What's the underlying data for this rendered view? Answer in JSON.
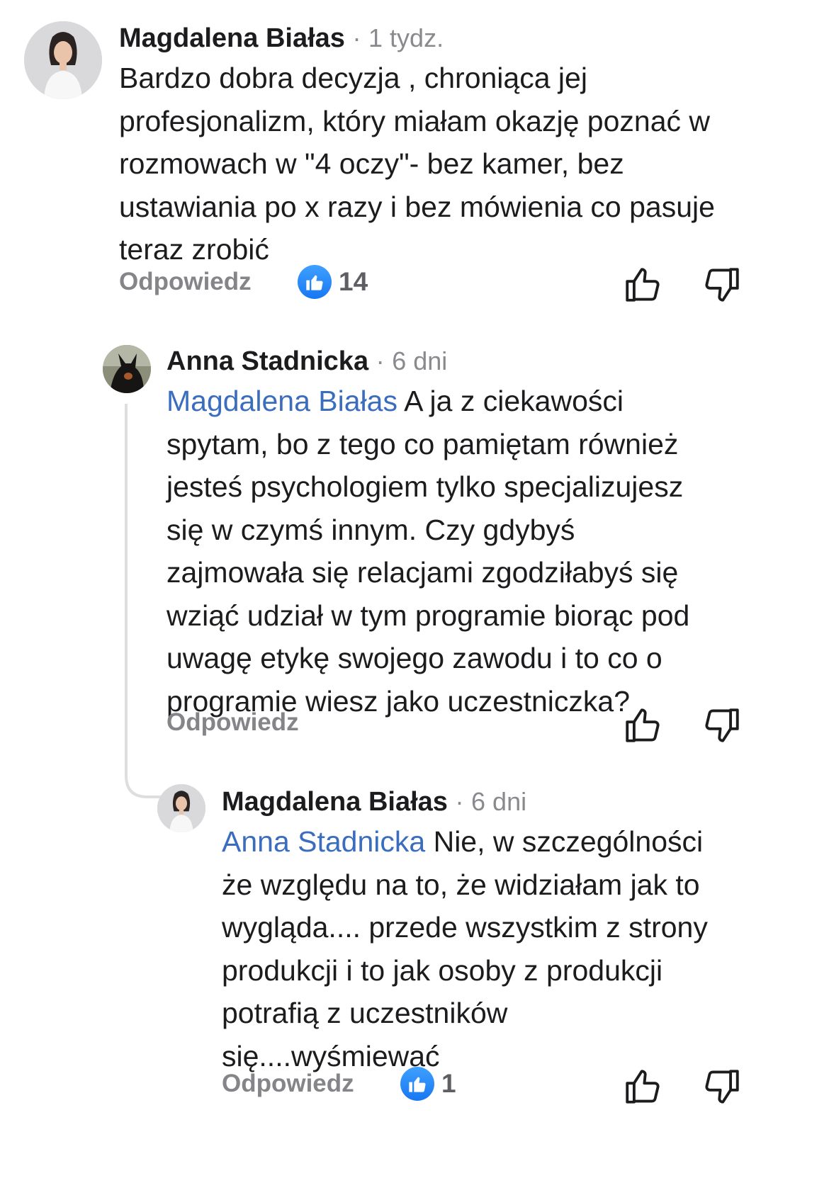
{
  "comment": {
    "author": "Magdalena Białas",
    "separator": "·",
    "time": "1 tydz.",
    "lines": [
      "Bardzo dobra decyzja , chroniąca jej",
      "profesjonalizm, który miałam okazję poznać w",
      "rozmowach w \"4 oczy\"- bez kamer, bez",
      "ustawiania po x razy i bez mówienia co pasuje",
      "teraz zrobić"
    ],
    "reply_label": "Odpowiedz",
    "reaction_count": "14",
    "reaction_icon": "like-icon"
  },
  "reply1": {
    "author": "Anna Stadnicka",
    "separator": "·",
    "time": "6 dni",
    "mention": "Magdalena Białas",
    "first_line_rest": " A ja z ciekawości",
    "lines": [
      "spytam, bo z tego co pamiętam również",
      "jesteś psychologiem tylko specjalizujesz",
      "się w czymś innym. Czy gdybyś",
      "zajmowała się relacjami zgodziłabyś się",
      "wziąć udział w tym programie biorąc pod",
      "uwagę etykę swojego zawodu i to co o",
      "programie wiesz jako uczestniczka?"
    ],
    "reply_label": "Odpowiedz"
  },
  "reply2": {
    "author": "Magdalena Białas",
    "separator": "·",
    "time": "6 dni",
    "mention": "Anna Stadnicka",
    "first_line_rest": " Nie, w szczególności",
    "lines": [
      "że względu na to, że widziałam jak to",
      "wygląda.... przede wszystkim z strony",
      "produkcji i to jak osoby z produkcji",
      "potrafią z uczestników",
      "się....wyśmiewać"
    ],
    "reply_label": "Odpowiedz",
    "reaction_count": "1",
    "reaction_icon": "like-icon"
  },
  "icons": {
    "upvote": "thumbs-up-outline-icon",
    "downvote": "thumbs-down-outline-icon"
  },
  "colors": {
    "mention": "#3b6dbf",
    "like_badge": "#1877f2",
    "muted": "#8a8a8e"
  }
}
